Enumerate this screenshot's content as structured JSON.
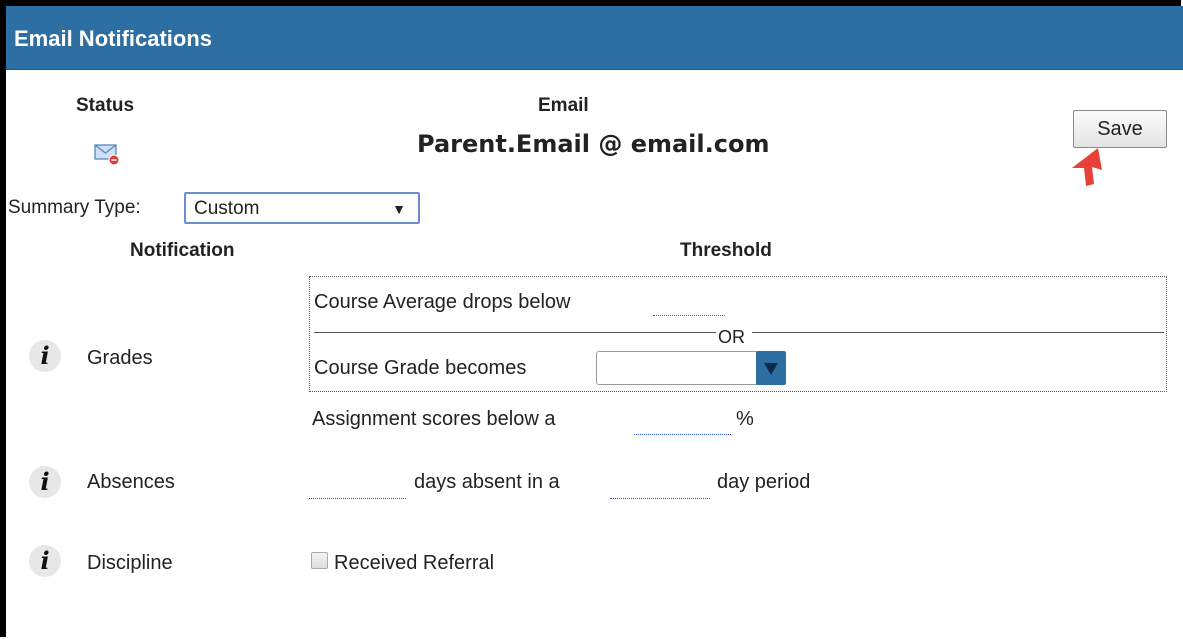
{
  "header": {
    "title": "Email Notifications"
  },
  "status": {
    "label": "Status",
    "icon": "envelope-alert-icon"
  },
  "email": {
    "label": "Email",
    "value": "Parent.Email @ email.com"
  },
  "toolbar": {
    "save_label": "Save"
  },
  "summary": {
    "label": "Summary Type:",
    "selected": "Custom"
  },
  "columns": {
    "notification": "Notification",
    "threshold": "Threshold"
  },
  "grades": {
    "label": "Grades",
    "course_average_text": "Course Average drops below",
    "course_average_value": "",
    "or_text": "OR",
    "course_grade_text": "Course Grade becomes",
    "course_grade_value": "",
    "assignment_text": "Assignment scores below a",
    "assignment_value": "",
    "assignment_unit": "%"
  },
  "absences": {
    "label": "Absences",
    "days_value": "",
    "days_text": "days absent in a",
    "period_value": "",
    "period_text": "day period"
  },
  "discipline": {
    "label": "Discipline",
    "checkbox_label": "Received Referral",
    "checked": false
  },
  "colors": {
    "header_bg": "#2e6fa3",
    "link_dotted": "#2a52d6",
    "arrow": "#e8413a",
    "dropdown_btn": "#2e6fa3"
  }
}
